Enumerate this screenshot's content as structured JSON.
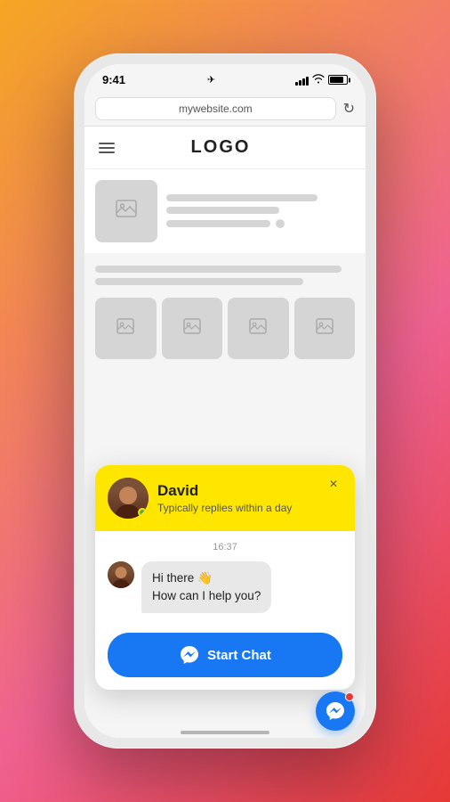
{
  "phone": {
    "status_bar": {
      "time": "9:41",
      "location_icon": "location-arrow"
    },
    "browser": {
      "url": "mywebsite.com",
      "refresh_label": "↻"
    },
    "website": {
      "logo": "LOGO"
    },
    "chat_popup": {
      "agent_name": "David",
      "agent_status": "Typically replies within a day",
      "close_label": "×",
      "timestamp": "16:37",
      "message": "Hi there 👋\nHow can I help you?",
      "start_chat_label": "Start Chat",
      "messenger_icon": "messenger"
    }
  }
}
